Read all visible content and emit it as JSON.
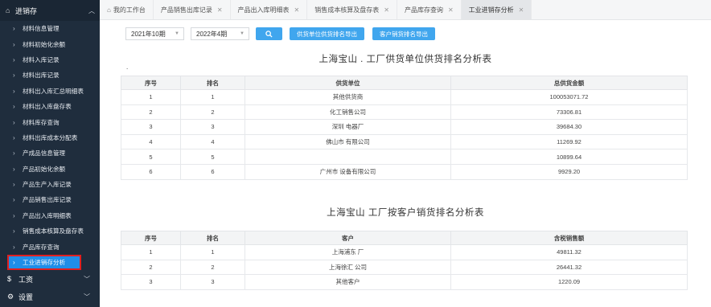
{
  "sidebar": {
    "group_label": "进销存",
    "items": [
      {
        "label": "材料信息管理"
      },
      {
        "label": "材料初始化余额"
      },
      {
        "label": "材料入库记录"
      },
      {
        "label": "材料出库记录"
      },
      {
        "label": "材料出入库汇总明细表"
      },
      {
        "label": "材料出入库盘存表"
      },
      {
        "label": "材料库存查询"
      },
      {
        "label": "材料出库成本分配表"
      },
      {
        "label": "产成品信息管理"
      },
      {
        "label": "产品初始化余额"
      },
      {
        "label": "产品生产入库记录"
      },
      {
        "label": "产品销售出库记录"
      },
      {
        "label": "产品出入库明细表"
      },
      {
        "label": "销售成本核算及盘存表"
      },
      {
        "label": "产品库存查询"
      },
      {
        "label": "工业进销存分析"
      }
    ],
    "bottom": [
      {
        "icon": "$",
        "label": "工资"
      },
      {
        "icon": "⚙",
        "label": "设置"
      }
    ]
  },
  "tabs": [
    {
      "label": "我的工作台"
    },
    {
      "label": "产品销售出库记录"
    },
    {
      "label": "产品出入库明细表"
    },
    {
      "label": "销售成本核算及盘存表"
    },
    {
      "label": "产品库存查询"
    },
    {
      "label": "工业进销存分析"
    }
  ],
  "filters": {
    "start": "2021年10期",
    "end": "2022年4期",
    "export_supplier": "供货单位供货排名导出",
    "export_customer": "客户销货排名导出"
  },
  "dot_text": ".",
  "supplier": {
    "title": "上海宝山  .   工厂供货单位供货排名分析表",
    "headers": [
      "序号",
      "排名",
      "供货单位",
      "总供货金额"
    ],
    "rows": [
      [
        "1",
        "1",
        "其他供货商",
        "100053071.72"
      ],
      [
        "2",
        "2",
        "化工销售公司",
        "73306.81"
      ],
      [
        "3",
        "3",
        "深圳        电器厂",
        "39684.30"
      ],
      [
        "4",
        "4",
        "佛山市              有限公司",
        "11269.92"
      ],
      [
        "5",
        "5",
        "",
        "10899.64"
      ],
      [
        "6",
        "6",
        "广州市              设备有限公司",
        "9929.20"
      ]
    ]
  },
  "customer": {
    "title": "上海宝山       工厂按客户销货排名分析表",
    "headers": [
      "序号",
      "排名",
      "客户",
      "含税销售额"
    ],
    "rows": [
      [
        "1",
        "1",
        "上海浦东        厂",
        "49811.32"
      ],
      [
        "2",
        "2",
        "上海徐汇       公司",
        "26441.32"
      ],
      [
        "3",
        "3",
        "其他客户",
        "1220.09"
      ]
    ]
  }
}
